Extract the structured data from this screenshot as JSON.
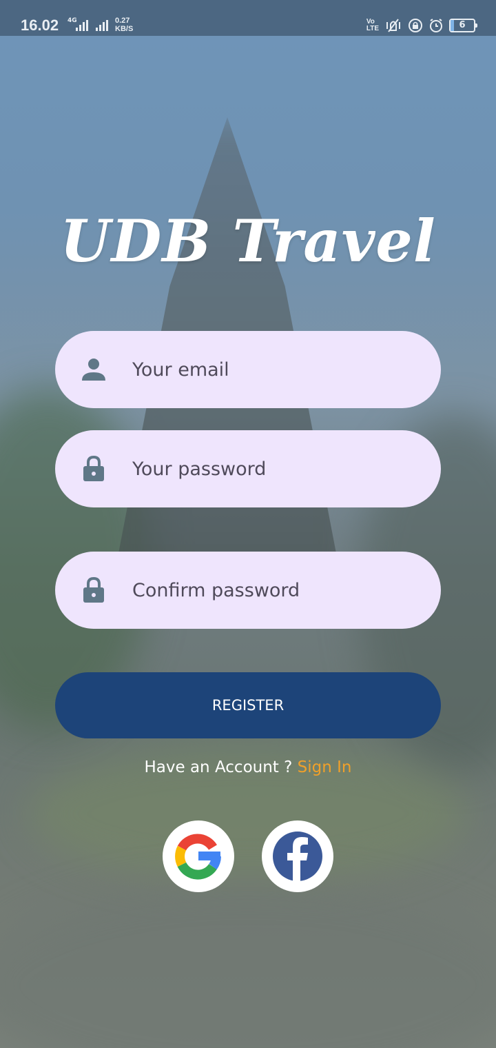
{
  "status_bar": {
    "time": "16.02",
    "network": "4G",
    "speed_value": "0.27",
    "speed_unit": "KB/S",
    "volte_top": "Vo",
    "volte_bottom": "LTE",
    "battery": "6"
  },
  "app": {
    "title": "UDB Travel"
  },
  "form": {
    "email_placeholder": "Your email",
    "password_placeholder": "Your password",
    "confirm_placeholder": "Confirm password",
    "register_label": "REGISTER",
    "account_prompt": "Have an Account ? ",
    "sign_in_label": "Sign In"
  },
  "colors": {
    "field_bg": "#efe5fd",
    "button_bg": "#1d4479",
    "link": "#f0a02a",
    "icon": "#5f7787"
  },
  "icons": {
    "email": "person-icon",
    "password": "lock-icon",
    "confirm": "lock-icon",
    "social": [
      "google-icon",
      "facebook-icon"
    ]
  }
}
